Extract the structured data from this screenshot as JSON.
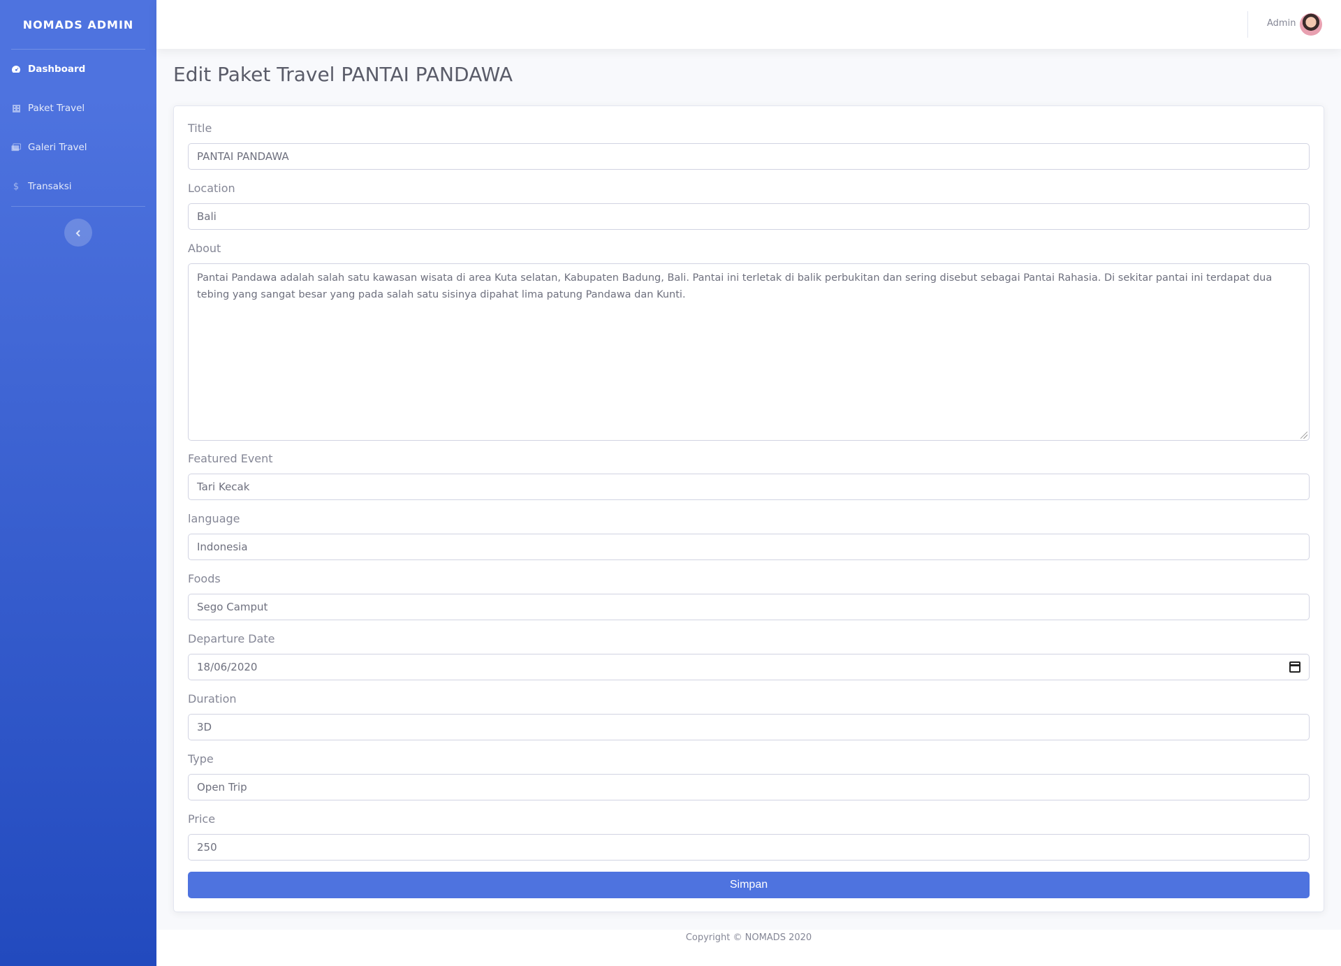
{
  "sidebar": {
    "brand": "NOMADS ADMIN",
    "items": [
      {
        "label": "Dashboard",
        "icon": "tachometer-icon"
      },
      {
        "label": "Paket Travel",
        "icon": "hotel-icon"
      },
      {
        "label": "Galeri Travel",
        "icon": "images-icon"
      },
      {
        "label": "Transaksi",
        "icon": "dollar-icon"
      }
    ]
  },
  "topbar": {
    "user_name": "Admin"
  },
  "page": {
    "title": "Edit Paket Travel PANTAI PANDAWA"
  },
  "form": {
    "title_label": "Title",
    "title_value": "PANTAI PANDAWA",
    "location_label": "Location",
    "location_value": "Bali",
    "about_label": "About",
    "about_value": "Pantai Pandawa adalah salah satu kawasan wisata di area Kuta selatan, Kabupaten Badung, Bali. Pantai ini terletak di balik perbukitan dan sering disebut sebagai Pantai Rahasia. Di sekitar pantai ini terdapat dua tebing yang sangat besar yang pada salah satu sisinya dipahat lima patung Pandawa dan Kunti.",
    "featured_event_label": "Featured Event",
    "featured_event_value": "Tari Kecak",
    "language_label": "language",
    "language_value": "Indonesia",
    "foods_label": "Foods",
    "foods_value": "Sego Camput",
    "departure_date_label": "Departure Date",
    "departure_date_value": "18/06/2020",
    "duration_label": "Duration",
    "duration_value": "3D",
    "type_label": "Type",
    "type_value": "Open Trip",
    "price_label": "Price",
    "price_value": "250",
    "submit_label": "Simpan"
  },
  "footer": {
    "copyright": "Copyright © NOMADS 2020"
  },
  "colors": {
    "primary": "#4e73df",
    "sidebar_gradient_end": "#224abe"
  }
}
